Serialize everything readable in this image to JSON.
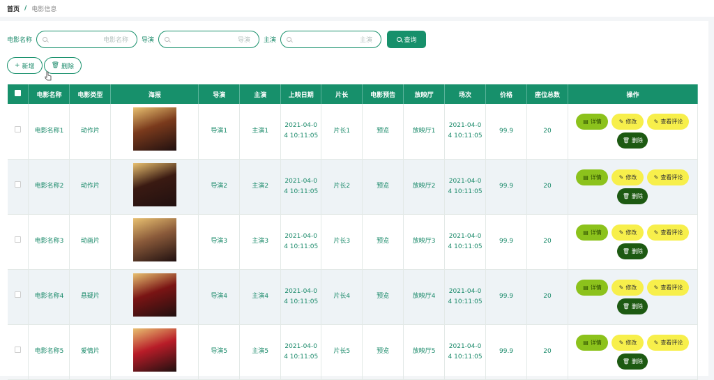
{
  "breadcrumb": {
    "home": "首页",
    "separator": "/",
    "current": "电影信息"
  },
  "search": {
    "fields": [
      {
        "label": "电影名称",
        "placeholder": "电影名称"
      },
      {
        "label": "导演",
        "placeholder": "导演"
      },
      {
        "label": "主演",
        "placeholder": "主演"
      }
    ],
    "query_label": "查询"
  },
  "actions": {
    "add_label": "新增",
    "delete_label": "删除"
  },
  "table": {
    "headers": [
      "电影名称",
      "电影类型",
      "海报",
      "导演",
      "主演",
      "上映日期",
      "片长",
      "电影预告",
      "放映厅",
      "场次",
      "价格",
      "座位总数",
      "操作"
    ],
    "rows": [
      {
        "name": "电影名称1",
        "type": "动作片",
        "director": "导演1",
        "star": "主演1",
        "date1": "2021-04-0",
        "date2": "4 10:11:05",
        "length": "片长1",
        "trailer": "预览",
        "hall": "放映厅1",
        "s1": "2021-04-0",
        "s2": "4 10:11:05",
        "price": "99.9",
        "seats": "20"
      },
      {
        "name": "电影名称2",
        "type": "动作片",
        "director": "导演2",
        "star": "主演2",
        "date1": "2021-04-0",
        "date2": "4 10:11:05",
        "length": "片长2",
        "trailer": "预览",
        "hall": "放映厅2",
        "s1": "2021-04-0",
        "s2": "4 10:11:05",
        "price": "99.9",
        "seats": "20"
      },
      {
        "name": "电影名称3",
        "type": "动画片",
        "director": "导演3",
        "star": "主演3",
        "date1": "2021-04-0",
        "date2": "4 10:11:05",
        "length": "片长3",
        "trailer": "预览",
        "hall": "放映厅3",
        "s1": "2021-04-0",
        "s2": "4 10:11:05",
        "price": "99.9",
        "seats": "20"
      },
      {
        "name": "电影名称4",
        "type": "悬疑片",
        "director": "导演4",
        "star": "主演4",
        "date1": "2021-04-0",
        "date2": "4 10:11:05",
        "length": "片长4",
        "trailer": "预览",
        "hall": "放映厅4",
        "s1": "2021-04-0",
        "s2": "4 10:11:05",
        "price": "99.9",
        "seats": "20"
      },
      {
        "name": "电影名称5",
        "type": "爱情片",
        "director": "导演5",
        "star": "主演5",
        "date1": "2021-04-0",
        "date2": "4 10:11:05",
        "length": "片长5",
        "trailer": "预览",
        "hall": "放映厅5",
        "s1": "2021-04-0",
        "s2": "4 10:11:05",
        "price": "99.9",
        "seats": "20"
      }
    ],
    "row_actions": {
      "detail": "详情",
      "edit": "修改",
      "review": "查看评论",
      "delete": "删除"
    }
  },
  "colors": {
    "primary": "#17906b",
    "detail": "#8cc21c",
    "edit": "#f7ef4b",
    "delete": "#1d5a12"
  },
  "posters": [
    "#7a3a1c",
    "#3a1a12",
    "#8a5a3a",
    "#7a1414",
    "#b81c28"
  ]
}
